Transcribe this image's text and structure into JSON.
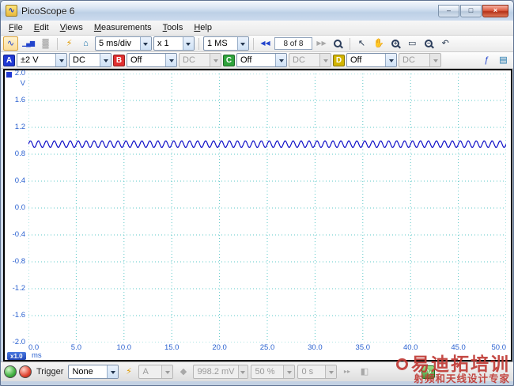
{
  "window": {
    "title": "PicoScope 6"
  },
  "icons": {
    "app": "∿",
    "minimize": "–",
    "maximize": "□",
    "close": "×",
    "scope_mode": "∿",
    "spectrum_mode": "▁▄▆",
    "persistence_mode": "▓",
    "auto_setup": "⚡",
    "home": "⌂",
    "prev_buffer": "◀◀",
    "next_buffer": "▶▶",
    "pointer_tool": "↖",
    "hand_tool": "✋",
    "zoom_in": "+",
    "zoom_out": "−",
    "marquee_zoom": "▭",
    "undo_zoom": "↶",
    "math_channels": "ƒ",
    "references": "▤",
    "trigger_marker": "◆",
    "rapid_trigger": "▸▸",
    "trigger_time": "◧",
    "signal_generator": "∿"
  },
  "menubar": {
    "items": [
      {
        "id": "file",
        "label": "File"
      },
      {
        "id": "edit",
        "label": "Edit"
      },
      {
        "id": "views",
        "label": "Views"
      },
      {
        "id": "measurements",
        "label": "Measurements"
      },
      {
        "id": "tools",
        "label": "Tools"
      },
      {
        "id": "help",
        "label": "Help"
      }
    ]
  },
  "toolbar": {
    "timebase": "5 ms/div",
    "zoom_factor": "x 1",
    "samples": "1 MS",
    "buffer_position": "8 of 8"
  },
  "channels": [
    {
      "name": "A",
      "range": "±2 V",
      "coupling": "DC",
      "color": "#2039d4",
      "enabled": true
    },
    {
      "name": "B",
      "range": "Off",
      "coupling": "DC",
      "color": "#e03030",
      "enabled": false
    },
    {
      "name": "C",
      "range": "Off",
      "coupling": "DC",
      "color": "#2fa33c",
      "enabled": false
    },
    {
      "name": "D",
      "range": "Off",
      "coupling": "DC",
      "color": "#d2b400",
      "enabled": false
    }
  ],
  "chart_data": {
    "type": "line",
    "title": "",
    "xlabel": "ms",
    "ylabel": "V",
    "xlim": [
      0,
      50
    ],
    "ylim": [
      -2,
      2
    ],
    "x_ticks": [
      "0.0",
      "5.0",
      "10.0",
      "15.0",
      "20.0",
      "25.0",
      "30.0",
      "35.0",
      "40.0",
      "45.0",
      "50.0"
    ],
    "y_ticks": [
      "2.0",
      "1.6",
      "1.2",
      "0.8",
      "0.4",
      "0.0",
      "-0.4",
      "-0.8",
      "-1.2",
      "-1.6",
      "-2.0"
    ],
    "grid": "dashed",
    "grid_color": "#5ec8c8",
    "zoom_badge": "x1.0",
    "series": [
      {
        "name": "Channel A",
        "color": "#1212c8",
        "shape": "sine",
        "offset_v": 0.95,
        "amplitude_v": 0.05,
        "cycles": 60
      }
    ]
  },
  "statusbar": {
    "trigger_label": "Trigger",
    "trigger_mode": "None",
    "trigger_source": "A",
    "trigger_threshold": "998.2 mV",
    "pre_trigger": "50 %",
    "trigger_delay": "0 s"
  },
  "watermark": {
    "line1": "易迪拓培训",
    "line2": "射频和天线设计专家",
    "color": "#c03a35"
  }
}
